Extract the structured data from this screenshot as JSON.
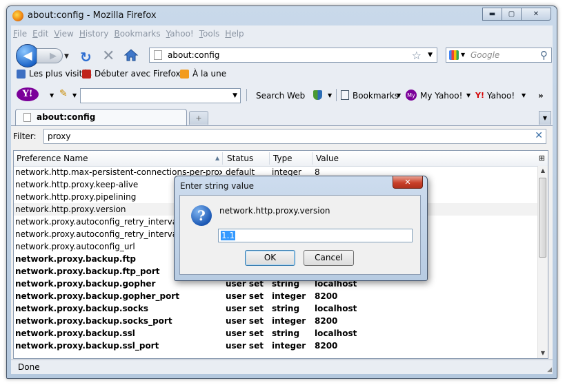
{
  "window": {
    "title": "about:config - Mozilla Firefox",
    "minimize": "▬",
    "maximize": "▢",
    "close": "✕"
  },
  "menu": [
    {
      "u": "F",
      "rest": "ile"
    },
    {
      "u": "E",
      "rest": "dit"
    },
    {
      "u": "V",
      "rest": "iew"
    },
    {
      "u": "H",
      "rest": "istory"
    },
    {
      "u": "B",
      "rest": "ookmarks"
    },
    {
      "u": "Y",
      "rest": "ahoo!"
    },
    {
      "u": "T",
      "rest": "ools"
    },
    {
      "u": "H",
      "rest": "elp"
    }
  ],
  "nav": {
    "url": "about:config",
    "search_placeholder": "Google"
  },
  "bookmarks_toolbar": [
    {
      "label": "Les plus visités",
      "icon": "most-visited-icon",
      "color": "#3d6fc2"
    },
    {
      "label": "Débuter avec Firefox",
      "icon": "firefox-bug-icon",
      "color": "#c0241b"
    },
    {
      "label": "À la une",
      "icon": "rss-icon",
      "color": "#f29b1d"
    }
  ],
  "yahoo_toolbar": {
    "logo": "Y!",
    "search_web": "Search Web",
    "bookmarks": "Bookmarks",
    "my_yahoo": "My Yahoo!",
    "yahoo": "Yahoo!",
    "overflow": "»"
  },
  "tab": {
    "label": "about:config"
  },
  "config": {
    "filter_label": "Filter:",
    "filter_value": "proxy",
    "columns": [
      "Preference Name",
      "Status",
      "Type",
      "Value"
    ],
    "rows": [
      {
        "name": "network.http.max-persistent-connections-per-proxy",
        "status": "default",
        "type": "integer",
        "value": "8",
        "bold": false
      },
      {
        "name": "network.http.proxy.keep-alive",
        "status": "",
        "type": "",
        "value": "",
        "bold": false
      },
      {
        "name": "network.http.proxy.pipelining",
        "status": "",
        "type": "",
        "value": "",
        "bold": false
      },
      {
        "name": "network.http.proxy.version",
        "status": "",
        "type": "",
        "value": "",
        "bold": false
      },
      {
        "name": "network.proxy.autoconfig_retry_interval_ma",
        "status": "",
        "type": "",
        "value": "",
        "bold": false
      },
      {
        "name": "network.proxy.autoconfig_retry_interval_mi",
        "status": "",
        "type": "",
        "value": "",
        "bold": false
      },
      {
        "name": "network.proxy.autoconfig_url",
        "status": "",
        "type": "",
        "value": "",
        "bold": false
      },
      {
        "name": "network.proxy.backup.ftp",
        "status": "",
        "type": "",
        "value": "",
        "bold": true
      },
      {
        "name": "network.proxy.backup.ftp_port",
        "status": "",
        "type": "",
        "value": "",
        "bold": true
      },
      {
        "name": "network.proxy.backup.gopher",
        "status": "user set",
        "type": "string",
        "value": "localhost",
        "bold": true
      },
      {
        "name": "network.proxy.backup.gopher_port",
        "status": "user set",
        "type": "integer",
        "value": "8200",
        "bold": true
      },
      {
        "name": "network.proxy.backup.socks",
        "status": "user set",
        "type": "string",
        "value": "localhost",
        "bold": true
      },
      {
        "name": "network.proxy.backup.socks_port",
        "status": "user set",
        "type": "integer",
        "value": "8200",
        "bold": true
      },
      {
        "name": "network.proxy.backup.ssl",
        "status": "user set",
        "type": "string",
        "value": "localhost",
        "bold": true
      },
      {
        "name": "network.proxy.backup.ssl_port",
        "status": "user set",
        "type": "integer",
        "value": "8200",
        "bold": true
      }
    ]
  },
  "status_bar": {
    "text": "Done"
  },
  "dialog": {
    "title": "Enter string value",
    "message": "network.http.proxy.version",
    "value": "1.1",
    "ok": "OK",
    "cancel": "Cancel",
    "close": "✕"
  }
}
